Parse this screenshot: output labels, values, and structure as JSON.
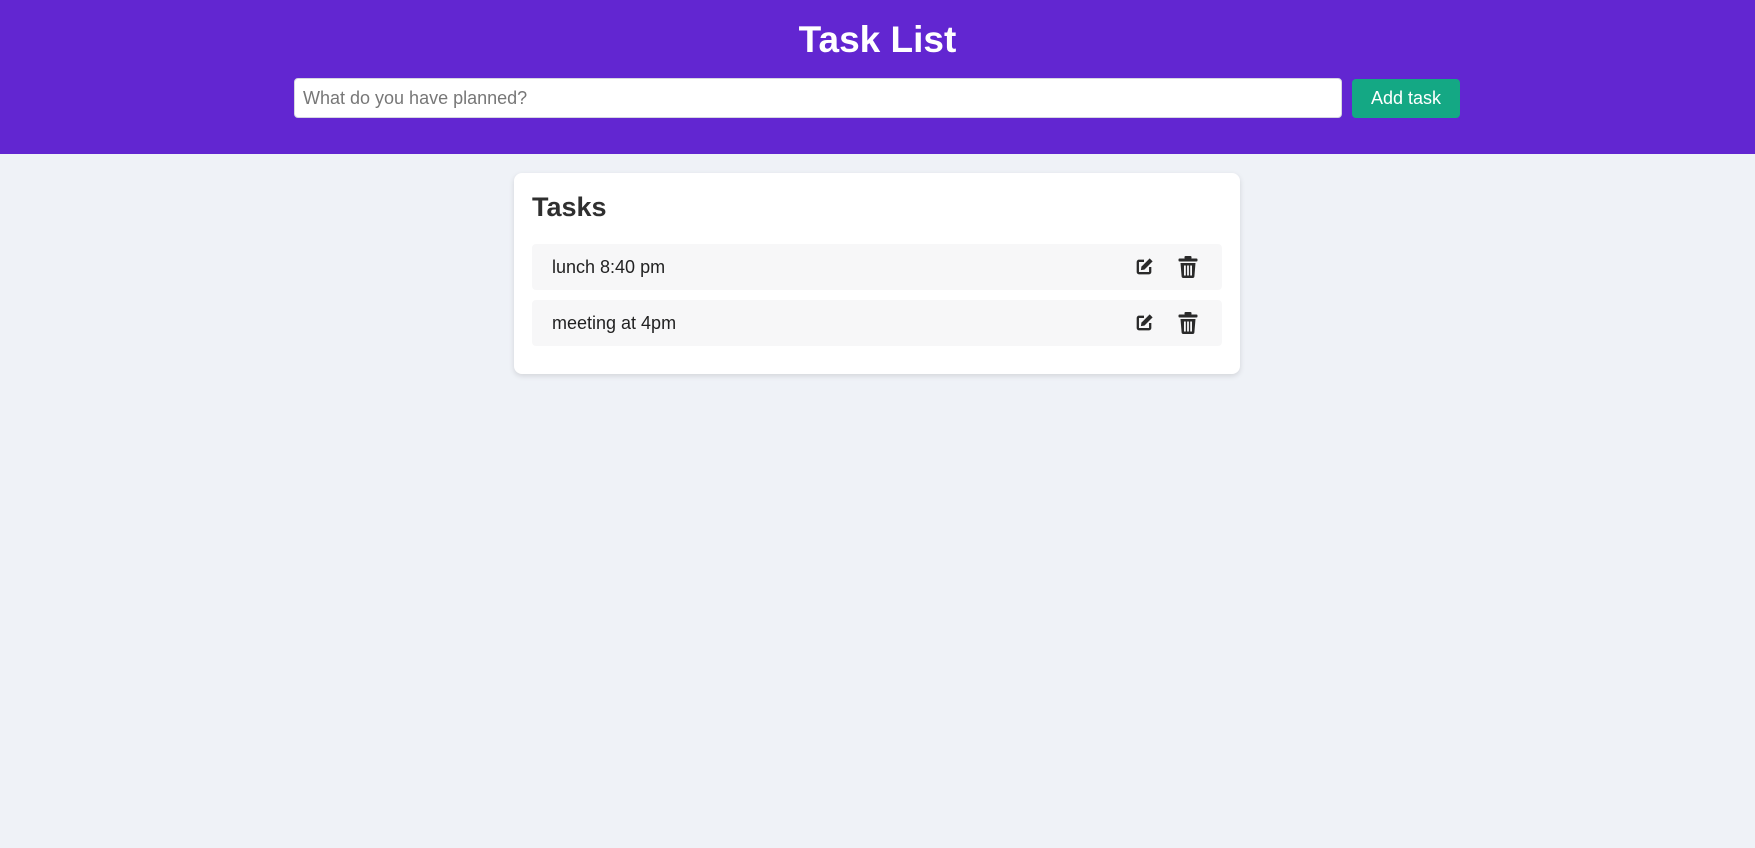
{
  "header": {
    "title": "Task List",
    "input_placeholder": "What do you have planned?",
    "input_value": "",
    "add_button_label": "Add task"
  },
  "tasks_panel": {
    "title": "Tasks",
    "items": [
      {
        "text": "lunch 8:40 pm",
        "edit_icon": "edit-icon",
        "delete_icon": "trash-icon"
      },
      {
        "text": "meeting at 4pm",
        "edit_icon": "edit-icon",
        "delete_icon": "trash-icon"
      }
    ]
  },
  "colors": {
    "header_bg": "#6226d1",
    "accent_button": "#14a884",
    "page_bg": "#eff2f7",
    "card_bg": "#ffffff",
    "task_bg": "#f7f7f8",
    "icon": "#2a2a2a"
  }
}
